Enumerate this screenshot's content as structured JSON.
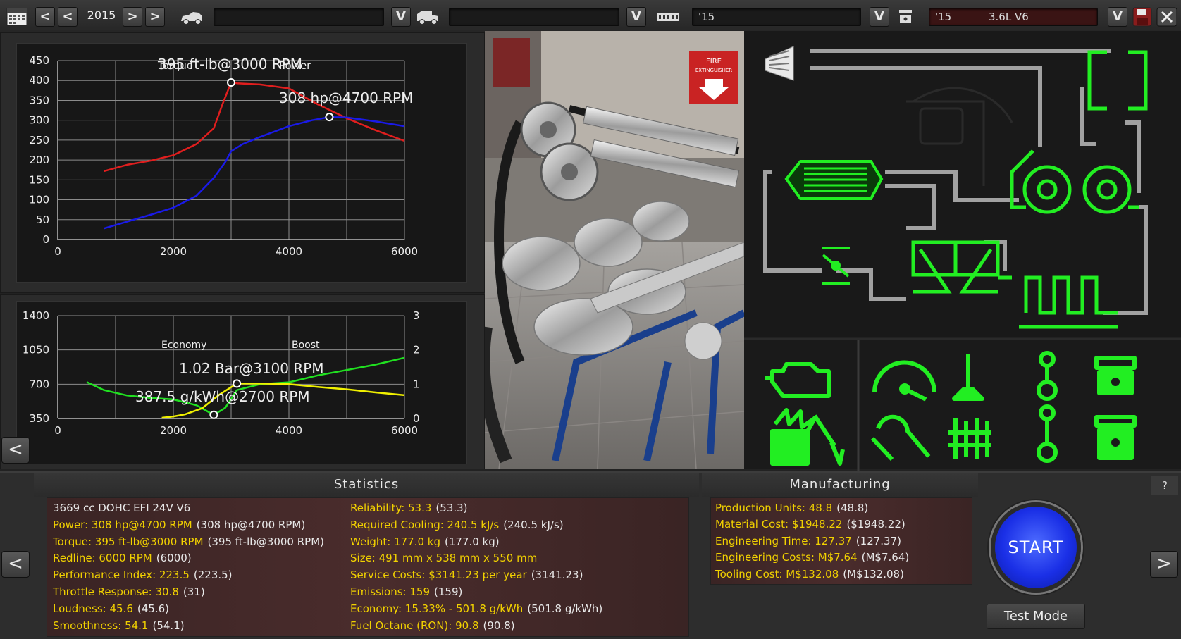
{
  "topbar": {
    "year": "2015",
    "prev_label": "<",
    "next_label": ">",
    "dropdown_label": "V",
    "car_field": "",
    "trim_field": "",
    "engine_field": "'15",
    "variant_year": "'15",
    "variant_name": "3.6L V6"
  },
  "power_chart": {
    "torque_label": "395 ft-lb@3000 RPM",
    "power_label": "308 hp@4700 RPM",
    "legend_torque": "Torque",
    "legend_power": "Power",
    "chart_data": {
      "type": "line",
      "x_ticks": [
        "0",
        "2000",
        "4000",
        "6000"
      ],
      "y_ticks": [
        "0",
        "50",
        "100",
        "150",
        "200",
        "250",
        "300",
        "350",
        "400",
        "450"
      ],
      "xlim": [
        0,
        6000
      ],
      "ylim": [
        0,
        450
      ],
      "series": [
        {
          "name": "Torque",
          "color": "#e01e1e",
          "x": [
            800,
            1200,
            1600,
            2000,
            2400,
            2700,
            2850,
            3000,
            3100,
            3500,
            4000,
            4500,
            5000,
            5500,
            6000
          ],
          "y": [
            172,
            188,
            198,
            212,
            240,
            280,
            340,
            395,
            393,
            390,
            380,
            340,
            305,
            275,
            248
          ]
        },
        {
          "name": "Power",
          "color": "#1a1ae8",
          "x": [
            800,
            1200,
            1600,
            2000,
            2400,
            2700,
            2900,
            3000,
            3200,
            3500,
            4000,
            4400,
            4700,
            5000,
            5500,
            6000
          ],
          "y": [
            28,
            45,
            62,
            80,
            110,
            155,
            195,
            222,
            240,
            258,
            285,
            300,
            308,
            307,
            297,
            285
          ]
        }
      ],
      "markers": [
        {
          "x": 3000,
          "y": 395
        },
        {
          "x": 4700,
          "y": 308
        }
      ]
    }
  },
  "economy_chart": {
    "boost_label": "1.02 Bar@3100 RPM",
    "economy_label": "387.5 g/kWh@2700 RPM",
    "legend_economy": "Economy",
    "legend_boost": "Boost",
    "chart_data": {
      "type": "line",
      "x_ticks": [
        "0",
        "2000",
        "4000",
        "6000"
      ],
      "y_ticks_left": [
        "350",
        "700",
        "1050",
        "1400"
      ],
      "y_ticks_right": [
        "0",
        "1",
        "2",
        "3"
      ],
      "xlim": [
        0,
        6000
      ],
      "ylim_left": [
        350,
        1400
      ],
      "ylim_right": [
        0,
        3
      ],
      "series": [
        {
          "name": "Economy",
          "axis": "left",
          "color": "#20e020",
          "x": [
            500,
            800,
            1200,
            1600,
            2000,
            2400,
            2700,
            2900,
            3100,
            3500,
            4000,
            4500,
            5000,
            5500,
            6000
          ],
          "y": [
            722,
            640,
            585,
            560,
            545,
            485,
            387,
            460,
            640,
            700,
            720,
            790,
            845,
            900,
            970
          ]
        },
        {
          "name": "Boost",
          "axis": "right",
          "color": "#f0f000",
          "x": [
            1800,
            2000,
            2200,
            2500,
            2800,
            3100,
            3500,
            4000,
            4500,
            5000,
            5500,
            6000
          ],
          "y": [
            0.02,
            0.06,
            0.12,
            0.3,
            0.7,
            1.02,
            1.02,
            1.0,
            0.92,
            0.85,
            0.76,
            0.68
          ]
        }
      ],
      "markers": [
        {
          "series": "Boost",
          "x": 3100,
          "y": 1.02
        },
        {
          "series": "Economy",
          "x": 2700,
          "y": 387.5
        }
      ]
    }
  },
  "view3d": {
    "sign_text_1": "FIRE",
    "sign_text_2": "EXTINGUISHER"
  },
  "nav": {
    "back_label": "<",
    "left_label": "<",
    "right_label": ">",
    "help_label": "?"
  },
  "statistics": {
    "title": "Statistics",
    "left": [
      {
        "k": "3669 cc DOHC EFI 24V V6",
        "v": ""
      },
      {
        "k": "Power: 308 hp@4700 RPM",
        "v": "(308 hp@4700 RPM)"
      },
      {
        "k": "Torque: 395 ft-lb@3000 RPM",
        "v": "(395 ft-lb@3000 RPM)"
      },
      {
        "k": "Redline: 6000 RPM",
        "v": "(6000)"
      },
      {
        "k": "Performance Index: 223.5",
        "v": "(223.5)"
      },
      {
        "k": "Throttle Response: 30.8",
        "v": "(31)"
      },
      {
        "k": "Loudness: 45.6",
        "v": "(45.6)"
      },
      {
        "k": "Smoothness: 54.1",
        "v": "(54.1)"
      }
    ],
    "right": [
      {
        "k": "Reliability: 53.3",
        "v": "(53.3)"
      },
      {
        "k": "Required Cooling: 240.5 kJ/s",
        "v": "(240.5 kJ/s)"
      },
      {
        "k": "Weight: 177.0 kg",
        "v": "(177.0 kg)"
      },
      {
        "k": "Size: 491 mm x 538 mm x 550 mm",
        "v": ""
      },
      {
        "k": "Service Costs: $3141.23 per year",
        "v": "(3141.23)"
      },
      {
        "k": "Emissions: 159",
        "v": "(159)"
      },
      {
        "k": "Economy: 15.33% - 501.8 g/kWh",
        "v": "(501.8 g/kWh)"
      },
      {
        "k": "Fuel Octane (RON): 90.8",
        "v": "(90.8)"
      }
    ]
  },
  "manufacturing": {
    "title": "Manufacturing",
    "rows": [
      {
        "k": "Production Units: 48.8",
        "v": "(48.8)"
      },
      {
        "k": "Material Cost: $1948.22",
        "v": "($1948.22)"
      },
      {
        "k": "Engineering Time: 127.37",
        "v": "(127.37)"
      },
      {
        "k": "Engineering Costs: M$7.64",
        "v": "(M$7.64)"
      },
      {
        "k": "Tooling Cost: M$132.08",
        "v": "(M$132.08)"
      }
    ]
  },
  "actions": {
    "start_label": "START",
    "test_mode_label": "Test Mode"
  },
  "colors": {
    "schematic_green": "#22ee22",
    "stat_yellow": "#f1d100",
    "start_blue": "#1a2fe6"
  },
  "icons": [
    "calendar-icon",
    "car-icon",
    "van-icon",
    "engine-block-icon",
    "piston-icon",
    "save-icon",
    "close-icon",
    "air-filter-icon",
    "intercooler-icon",
    "turbo-icon",
    "throttle-icon",
    "intake-manifold-icon",
    "exhaust-icon",
    "check-engine-icon",
    "gauge-icon",
    "valve-icon",
    "conrod-icon",
    "fuel-icon",
    "wrench-icon",
    "camshaft-icon"
  ]
}
